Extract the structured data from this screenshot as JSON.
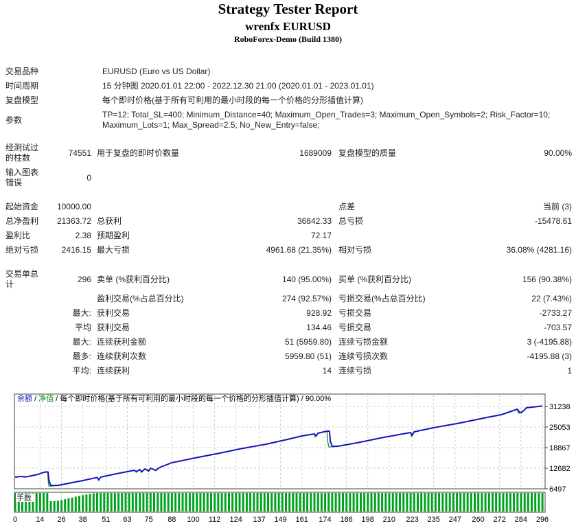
{
  "header": {
    "title": "Strategy Tester Report",
    "symbol": "wrenfx EURUSD",
    "server": "RoboForex-Demo (Build 1380)"
  },
  "info_rows": [
    {
      "label": "交易品种",
      "value": "EURUSD (Euro vs US Dollar)"
    },
    {
      "label": "时间周期",
      "value": "15 分钟图 2020.01.01 22:00 - 2022.12.30 21:00 (2020.01.01 - 2023.01.01)"
    },
    {
      "label": "复盘模型",
      "value": "每个即时价格(基于所有可利用的最小时段的每一个价格的分形插值计算)"
    },
    {
      "label": "参数",
      "value": "TP=12; Total_SL=400; Minimum_Distance=40; Maximum_Open_Trades=3; Maximum_Open_Symbols=2; Risk_Factor=10; Maximum_Lots=1; Max_Spread=2.5; No_New_Entry=false;"
    }
  ],
  "stat_rows": [
    {
      "cells": [
        "经测试过的柱数",
        "74551",
        "用于复盘的即时价数量",
        "1689009",
        "复盘模型的质量",
        "90.00%"
      ],
      "gap_before": false
    },
    {
      "cells": [
        "输入图表错误",
        "0",
        "",
        "",
        "",
        ""
      ],
      "gap_before": false
    },
    {
      "cells": [
        "起始资金",
        "10000.00",
        "",
        "",
        "点差",
        "当前 (3)"
      ],
      "gap_before": true
    },
    {
      "cells": [
        "总净盈利",
        "21363.72",
        "总获利",
        "36842.33",
        "总亏损",
        "-15478.61"
      ],
      "gap_before": false
    },
    {
      "cells": [
        "盈利比",
        "2.38",
        "预期盈利",
        "72.17",
        "",
        ""
      ],
      "gap_before": false
    },
    {
      "cells": [
        "绝对亏损",
        "2416.15",
        "最大亏损",
        "4961.68 (21.35%)",
        "相对亏损",
        "36.08% (4281.16)"
      ],
      "gap_before": false
    },
    {
      "cells": [
        "交易单总计",
        "296",
        "卖单 (%获利百分比)",
        "140 (95.00%)",
        "买单 (%获利百分比)",
        "156 (90.38%)"
      ],
      "gap_before": true
    },
    {
      "cells": [
        "",
        "",
        "盈利交易(%占总百分比)",
        "274 (92.57%)",
        "亏损交易(%占总百分比)",
        "22 (7.43%)"
      ],
      "gap_before": false
    },
    {
      "cells": [
        "",
        "最大:",
        "获利交易",
        "928.92",
        "亏损交易",
        "-2733.27"
      ],
      "gap_before": false
    },
    {
      "cells": [
        "",
        "平均",
        "获利交易",
        "134.46",
        "亏损交易",
        "-703.57"
      ],
      "gap_before": false
    },
    {
      "cells": [
        "",
        "最大:",
        "连续获利金额",
        "51 (5959.80)",
        "连续亏损金额",
        "3 (-4195.88)"
      ],
      "gap_before": false
    },
    {
      "cells": [
        "",
        "最多:",
        "连续获利次数",
        "5959.80 (51)",
        "连续亏损次数",
        "-4195.88 (3)"
      ],
      "gap_before": false
    },
    {
      "cells": [
        "",
        "平均:",
        "连续获利",
        "14",
        "连续亏损",
        "1"
      ],
      "gap_before": false
    }
  ],
  "chart_data": {
    "type": "line",
    "legend_parts": [
      {
        "text": "余额",
        "color": "#1414b8"
      },
      {
        "text": " / ",
        "color": "#000000"
      },
      {
        "text": "净值",
        "color": "#009423"
      },
      {
        "text": " / 每个即时价格(基于所有可利用的最小时段的每一个价格的分形插值计算) / 90.00%",
        "color": "#000000"
      }
    ],
    "lots_label": "手数",
    "y_ticks": [
      31238,
      25053,
      18867,
      12682,
      6497
    ],
    "x_ticks": [
      0,
      14,
      26,
      38,
      51,
      63,
      75,
      88,
      100,
      112,
      124,
      137,
      149,
      161,
      174,
      186,
      198,
      210,
      223,
      235,
      247,
      260,
      272,
      284,
      296
    ],
    "x_range": [
      0,
      296
    ],
    "xlabel": "",
    "ylabel": "",
    "series": [
      {
        "name": "余额",
        "points": [
          [
            0,
            10000
          ],
          [
            3,
            10200
          ],
          [
            6,
            10050
          ],
          [
            9,
            10400
          ],
          [
            13,
            10850
          ],
          [
            15,
            11250
          ],
          [
            17,
            11550
          ],
          [
            18.5,
            11550
          ],
          [
            19,
            8950
          ],
          [
            20,
            7550
          ],
          [
            24,
            7530
          ],
          [
            38,
            8970
          ],
          [
            46,
            9900
          ],
          [
            47,
            9180
          ],
          [
            48,
            10000
          ],
          [
            57,
            11030
          ],
          [
            67,
            12060
          ],
          [
            68,
            11650
          ],
          [
            70,
            12270
          ],
          [
            71,
            11650
          ],
          [
            73,
            12480
          ],
          [
            75,
            11860
          ],
          [
            76,
            12680
          ],
          [
            79,
            12060
          ],
          [
            81,
            12890
          ],
          [
            88,
            14330
          ],
          [
            101,
            15770
          ],
          [
            115,
            17220
          ],
          [
            126,
            18460
          ],
          [
            141,
            19900
          ],
          [
            153,
            21340
          ],
          [
            161,
            22370
          ],
          [
            168,
            22990
          ],
          [
            169,
            22370
          ],
          [
            170,
            23200
          ],
          [
            175,
            23810
          ],
          [
            176.5,
            23810
          ],
          [
            177,
            20720
          ],
          [
            178,
            19280
          ],
          [
            181,
            19280
          ],
          [
            192,
            20310
          ],
          [
            207,
            21960
          ],
          [
            222,
            23400
          ],
          [
            223,
            22580
          ],
          [
            224,
            23610
          ],
          [
            235,
            24850
          ],
          [
            250,
            26290
          ],
          [
            265,
            27940
          ],
          [
            273,
            28760
          ],
          [
            282,
            30410
          ],
          [
            283,
            29590
          ],
          [
            284,
            29380
          ],
          [
            286,
            30210
          ],
          [
            287,
            30820
          ],
          [
            296,
            31364
          ]
        ]
      },
      {
        "name": "净值",
        "points": [
          [
            0,
            10000
          ],
          [
            3,
            10200
          ],
          [
            6,
            10050
          ],
          [
            9,
            10400
          ],
          [
            13,
            10850
          ],
          [
            15,
            11250
          ],
          [
            17,
            11550
          ],
          [
            18.3,
            11550
          ],
          [
            18.7,
            8100
          ],
          [
            19,
            7300
          ],
          [
            24,
            7420
          ],
          [
            38,
            8970
          ],
          [
            46,
            9900
          ],
          [
            47,
            9000
          ],
          [
            48,
            10000
          ],
          [
            57,
            11030
          ],
          [
            67,
            12060
          ],
          [
            68,
            11450
          ],
          [
            70,
            12270
          ],
          [
            71,
            11400
          ],
          [
            73,
            12480
          ],
          [
            75,
            11700
          ],
          [
            76,
            12680
          ],
          [
            79,
            11900
          ],
          [
            81,
            12890
          ],
          [
            88,
            14330
          ],
          [
            101,
            15770
          ],
          [
            115,
            17220
          ],
          [
            126,
            18460
          ],
          [
            141,
            19900
          ],
          [
            153,
            21340
          ],
          [
            161,
            22370
          ],
          [
            168,
            22990
          ],
          [
            168.5,
            22100
          ],
          [
            170,
            23200
          ],
          [
            175,
            23810
          ],
          [
            175.6,
            20500
          ],
          [
            176.2,
            19050
          ],
          [
            181,
            19200
          ],
          [
            192,
            20310
          ],
          [
            207,
            21960
          ],
          [
            222,
            23400
          ],
          [
            222.5,
            22250
          ],
          [
            224,
            23610
          ],
          [
            235,
            24850
          ],
          [
            250,
            26290
          ],
          [
            265,
            27940
          ],
          [
            273,
            28760
          ],
          [
            282,
            30410
          ],
          [
            282.5,
            29250
          ],
          [
            284,
            29250
          ],
          [
            286,
            30210
          ],
          [
            287,
            30820
          ],
          [
            296,
            31364
          ]
        ]
      }
    ],
    "lots_profile": [
      [
        0,
        1
      ],
      [
        18,
        1
      ],
      [
        19,
        0.55
      ],
      [
        24,
        0.58
      ],
      [
        28,
        0.66
      ],
      [
        34,
        0.8
      ],
      [
        40,
        0.92
      ],
      [
        45,
        1
      ],
      [
        296,
        1
      ]
    ],
    "colors": {
      "balance": "#1414b8",
      "equity": "#009423",
      "lots": "#00a31c",
      "grid": "#cdcdcd",
      "border": "#444444",
      "axis_text": "#000000"
    }
  }
}
